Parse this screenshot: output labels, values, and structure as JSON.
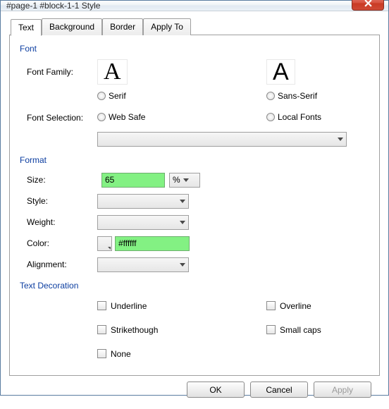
{
  "window": {
    "title": "#page-1 #block-1-1 Style"
  },
  "tabs": {
    "text": "Text",
    "background": "Background",
    "border": "Border",
    "applyto": "Apply To"
  },
  "font": {
    "section": "Font",
    "family_label": "Font Family:",
    "serif": "Serif",
    "sans": "Sans-Serif",
    "selection_label": "Font Selection:",
    "websafe": "Web Safe",
    "local": "Local Fonts"
  },
  "format": {
    "section": "Format",
    "size_label": "Size:",
    "size_value": "65",
    "unit": "%",
    "style_label": "Style:",
    "weight_label": "Weight:",
    "color_label": "Color:",
    "color_value": "#ffffff",
    "alignment_label": "Alignment:"
  },
  "deco": {
    "section": "Text Decoration",
    "underline": "Underline",
    "overline": "Overline",
    "strike": "Strikethough",
    "small": "Small caps",
    "none": "None"
  },
  "footer": {
    "ok": "OK",
    "cancel": "Cancel",
    "apply": "Apply"
  }
}
